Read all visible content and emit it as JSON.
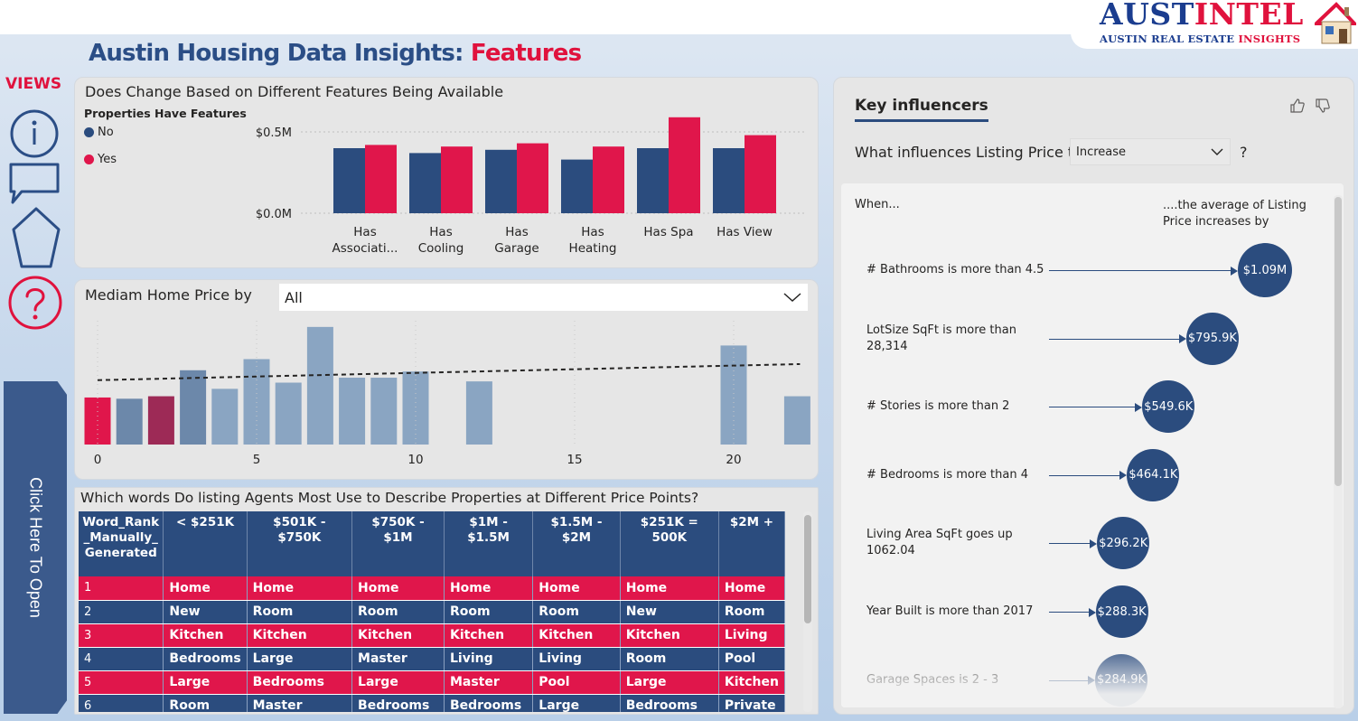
{
  "logo": {
    "main_prefix": "AUST",
    "main_accent": "INTEL",
    "sub_prefix": "AUSTIN REAL ESTATE ",
    "sub_accent": "INSIGHTS",
    "icon": "house-icon"
  },
  "header": {
    "title_main": "Austin Housing Data Insights: ",
    "title_accent": "Features"
  },
  "sidebar": {
    "views_label": "VIEWS",
    "icons": [
      "info-icon",
      "chat-icon",
      "pentagon-icon",
      "help-icon"
    ],
    "open_tab_label": "Click Here To Open"
  },
  "colors": {
    "no": "#2b4c7e",
    "yes": "#e0164b",
    "accent_blue": "#2b4e86",
    "accent_red": "#e0123d"
  },
  "features_chart": {
    "title": "Does Change Based on Different Features Being Available",
    "legend_title": "Properties Have Features",
    "legend": [
      {
        "label": "No",
        "color": "#2b4c7e"
      },
      {
        "label": "Yes",
        "color": "#e0164b"
      }
    ],
    "y_ticks": [
      "$0.5M",
      "$0.0M"
    ]
  },
  "median_chart": {
    "title": "Mediam Home Price by",
    "dropdown_value": "All",
    "x_ticks": [
      "0",
      "5",
      "10",
      "15",
      "20"
    ]
  },
  "chart_data": [
    {
      "type": "bar",
      "title": "Does Change Based on Different Features Being Available",
      "categories": [
        "Has Associati...",
        "Has Cooling",
        "Has Garage",
        "Has Heating",
        "Has Spa",
        "Has View"
      ],
      "category_lines": [
        [
          "Has",
          "Associati..."
        ],
        [
          "Has",
          "Cooling"
        ],
        [
          "Has",
          "Garage"
        ],
        [
          "Has",
          "Heating"
        ],
        [
          "Has Spa"
        ],
        [
          "Has View"
        ]
      ],
      "series": [
        {
          "name": "No",
          "values": [
            0.4,
            0.37,
            0.39,
            0.33,
            0.4,
            0.4
          ]
        },
        {
          "name": "Yes",
          "values": [
            0.42,
            0.41,
            0.43,
            0.41,
            0.59,
            0.48
          ]
        }
      ],
      "ylabel": "",
      "ylim": [
        0,
        0.6
      ],
      "grid": true,
      "legend_position": "left"
    },
    {
      "type": "bar",
      "title": "Mediam Home Price by",
      "x": [
        0,
        1,
        2,
        3,
        4,
        5,
        6,
        7,
        8,
        9,
        10,
        12,
        20,
        22
      ],
      "values": [
        0.38,
        0.37,
        0.39,
        0.6,
        0.45,
        0.69,
        0.5,
        0.95,
        0.54,
        0.54,
        0.59,
        0.51,
        0.8,
        0.39
      ],
      "bar_colors": [
        "#e0164b",
        "#6c88aa",
        "#9d2a56",
        "#6c88aa",
        "#8aa5c2",
        "#8aa5c2",
        "#8aa5c2",
        "#8aa5c2",
        "#8aa5c2",
        "#8aa5c2",
        "#8aa5c2",
        "#8aa5c2",
        "#8aa5c2",
        "#8aa5c2"
      ],
      "xlim": [
        -0.5,
        22.5
      ],
      "ylim": [
        0,
        1
      ],
      "trendline": [
        [
          0,
          0.52
        ],
        [
          22,
          0.65
        ]
      ],
      "grid": false
    }
  ],
  "words_table": {
    "title": "Which words Do listing Agents Most Use to Describe Properties at Different Price Points?",
    "headers": [
      "Word_Rank _Manually_ Generated",
      "< $251K",
      "$501K - $750K",
      "$750K - $1M",
      "$1M - $1.5M",
      "$1.5M - $2M",
      "$251K = 500K",
      "$2M +"
    ],
    "rows": [
      [
        "1",
        "Home",
        "Home",
        "Home",
        "Home",
        "Home",
        "Home",
        "Home"
      ],
      [
        "2",
        "New",
        "Room",
        "Room",
        "Room",
        "Room",
        "New",
        "Room"
      ],
      [
        "3",
        "Kitchen",
        "Kitchen",
        "Kitchen",
        "Kitchen",
        "Kitchen",
        "Kitchen",
        "Living"
      ],
      [
        "4",
        "Bedrooms",
        "Large",
        "Master",
        "Living",
        "Living",
        "Room",
        "Pool"
      ],
      [
        "5",
        "Large",
        "Bedrooms",
        "Large",
        "Master",
        "Pool",
        "Large",
        "Kitchen"
      ],
      [
        "6",
        "Room",
        "Master",
        "Bedrooms",
        "Bedrooms",
        "Large",
        "Bedrooms",
        "Private"
      ]
    ]
  },
  "key_influencers": {
    "tab_label": "Key influencers",
    "question_prefix": "What influences Listing Price to",
    "question_value": "Increase",
    "question_suffix": "?",
    "when_label": "When...",
    "avg_label": "....the average of Listing Price increases by",
    "items": [
      {
        "label": "# Bathrooms is more than 4.5",
        "value": "$1.09M",
        "impact": 1.09
      },
      {
        "label": "LotSize SqFt is more than 28,314",
        "value": "$795.9K",
        "impact": 0.7959
      },
      {
        "label": "# Stories is more than 2",
        "value": "$549.6K",
        "impact": 0.5496
      },
      {
        "label": "# Bedrooms is more than 4",
        "value": "$464.1K",
        "impact": 0.4641
      },
      {
        "label": "Living Area SqFt goes up 1062.04",
        "value": "$296.2K",
        "impact": 0.2962
      },
      {
        "label": "Year Built is more than 2017",
        "value": "$288.3K",
        "impact": 0.2883
      },
      {
        "label": "Garage Spaces is 2 - 3",
        "value": "$284.9K",
        "impact": 0.2849
      }
    ]
  }
}
